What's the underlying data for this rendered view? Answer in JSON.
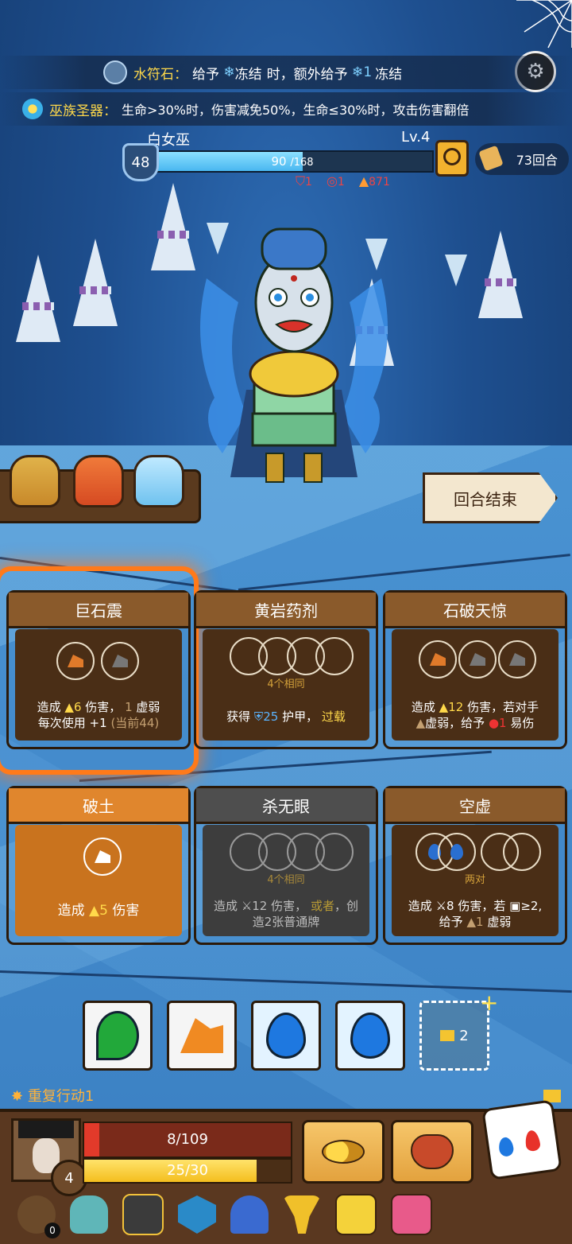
{
  "banners": {
    "water_rune": {
      "label": "水符石：",
      "text_a": "给予",
      "freeze_a": "冻结",
      "text_b": "时，额外给予",
      "freeze_count": "1",
      "freeze_b": "冻结"
    },
    "tribe_relic": {
      "label": "巫族圣器：",
      "text": "生命>30%时，伤害减免50%，生命≤30%时，攻击伤害翻倍"
    }
  },
  "enemy": {
    "name": "白女巫",
    "level": "Lv.4",
    "shield": "48",
    "hp_current": "90",
    "hp_max": "/168",
    "hp_fraction": 0.536,
    "status": {
      "defense_down": "1",
      "target": "1",
      "fire": "871"
    }
  },
  "round": {
    "label": "73回合"
  },
  "end_turn": {
    "label": "回合结束"
  },
  "cards": [
    {
      "title": "巨石震",
      "line1_a": "造成",
      "line1_val": "6",
      "line1_b": "伤害，",
      "line1_c": "1",
      "line1_d": "虚弱",
      "line2_a": "每次使用",
      "line2_b": "+1",
      "line2_c": "(当前44)"
    },
    {
      "title": "黄岩药剂",
      "cond": "4个相同",
      "line1_a": "获得",
      "line1_val": "25",
      "line1_b": "护甲，",
      "line1_c": "过载"
    },
    {
      "title": "石破天惊",
      "line1_a": "造成",
      "line1_val": "12",
      "line1_b": "伤害，若对手",
      "line2_a": "虚弱，给予",
      "line2_val": "1",
      "line2_b": "易伤"
    },
    {
      "title": "破土",
      "line1_a": "造成",
      "line1_val": "5",
      "line1_b": "伤害"
    },
    {
      "title": "杀无眼",
      "cond": "4个相同",
      "line1_a": "造成",
      "line1_val": "12",
      "line1_b": "伤害，",
      "line1_c": "或者",
      "line1_d": "，创",
      "line2_a": "造2张普通牌"
    },
    {
      "title": "空虚",
      "cond": "两对",
      "line1_a": "造成",
      "line1_val": "8",
      "line1_b": "伤害，若",
      "line1_c": "≥2,",
      "line2_a": "给予",
      "line2_val": "1",
      "line2_b": "虚弱"
    }
  ],
  "dice_tray": {
    "buy_count": "2"
  },
  "repeat_action": "重复行动1",
  "player": {
    "level": "4",
    "hp": "8/109",
    "hp_fraction": 0.073,
    "energy": "25/30",
    "energy_fraction": 0.833
  },
  "inventory": {
    "bag_count": "0"
  },
  "colors": {
    "accent_yellow": "#ffd94a",
    "hp_red": "#e23a2a",
    "energy_yellow": "#f4be1e",
    "ice_blue": "#49b7f0"
  }
}
